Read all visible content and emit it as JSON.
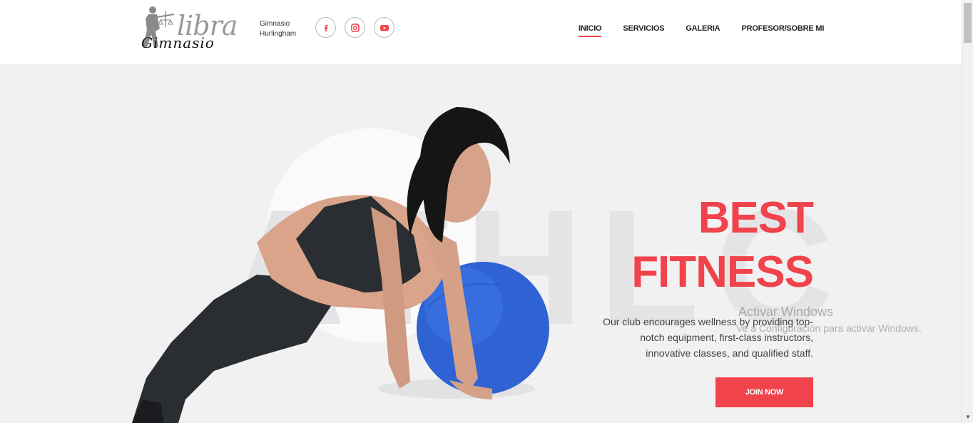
{
  "brand": {
    "logo_word": "libra",
    "logo_subword": "Gimnasio",
    "gym_name": "Gimnasio Hurlingham"
  },
  "social": [
    {
      "name": "facebook-icon",
      "glyph": "f"
    },
    {
      "name": "instagram-icon",
      "glyph": "◙"
    },
    {
      "name": "youtube-icon",
      "glyph": "▶"
    }
  ],
  "nav": {
    "items": [
      "INICIO",
      "SERVICIOS",
      "GALERIA",
      "PROFESOR/SOBRE MI"
    ],
    "active_index": 0
  },
  "hero": {
    "background_word": "ATHLC",
    "title_line1": "BEST",
    "title_line2": "FITNESS",
    "description": "Our club encourages wellness by providing top-notch equipment, first-class instructors, innovative classes, and qualified staff.",
    "cta_label": "JOIN NOW"
  },
  "watermark": {
    "line1": "Activar Windows",
    "line2": "Ve a Configuración para activar Windows."
  },
  "colors": {
    "accent": "#f0434b",
    "hero_bg": "#f1f1f2",
    "ball": "#2b5fd0",
    "outfit": "#2a2e33"
  }
}
